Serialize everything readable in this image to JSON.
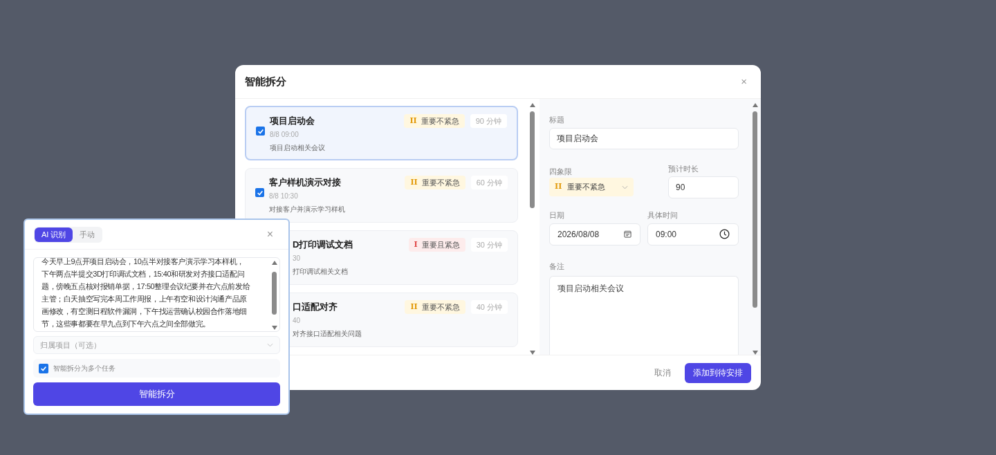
{
  "dialog": {
    "title": "智能拆分",
    "close": "×",
    "tasks": [
      {
        "title": "项目启动会",
        "time": "8/8 09:00",
        "note": "项目启动相关会议",
        "checked": true,
        "selected": true,
        "badge": {
          "mark": "II",
          "label": "重要不紧急",
          "kind": "not_urgent"
        },
        "duration": "90 分钟"
      },
      {
        "title": "客户样机演示对接",
        "time": "8/8 10:30",
        "note": "对接客户并演示学习样机",
        "checked": true,
        "selected": false,
        "badge": {
          "mark": "II",
          "label": "重要不紧急",
          "kind": "not_urgent"
        },
        "duration": "60 分钟"
      },
      {
        "title": "D打印调试文档",
        "time": "30",
        "note": "打印调试相关文档",
        "selected": false,
        "badge": {
          "mark": "I",
          "label": "重要且紧急",
          "kind": "urgent"
        },
        "duration": "30 分钟"
      },
      {
        "title": "口适配对齐",
        "time": "40",
        "note": "对齐接口适配相关问题",
        "selected": false,
        "badge": {
          "mark": "II",
          "label": "重要不紧急",
          "kind": "not_urgent"
        },
        "duration": "40 分钟"
      }
    ],
    "form": {
      "title_label": "标题",
      "title_value": "项目启动会",
      "quadrant_label": "四象限",
      "quadrant": {
        "mark": "II",
        "label": "重要不紧急",
        "kind": "not_urgent"
      },
      "duration_label": "预计时长",
      "duration_value": "90",
      "date_label": "日期",
      "date_value": "2026/08/08",
      "time_label": "具体时间",
      "time_value": "09:00",
      "note_label": "备注",
      "note_value": "项目启动相关会议"
    },
    "buttons": [
      {
        "label": "取消",
        "kind": "secondary"
      },
      {
        "label": "添加到待安排",
        "kind": "primary"
      }
    ]
  },
  "input_panel": {
    "tabs": [
      {
        "label": "AI 识别",
        "selected": true
      },
      {
        "label": "手动",
        "selected": false
      }
    ],
    "close": "×",
    "text_lines": [
      "今天早上9点开项目启动会，10点半对接客户演示学习本样机，",
      "下午两点半提交3D打印调试文档，15:40和研发对齐接口适配问",
      "题，傍晚五点核对报销单据，17:50整理会议纪要并在六点前发给",
      "主管；白天抽空写完本周工作周报，上午有空和设计沟通产品原",
      "画修改，有空测日程软件漏洞，下午找运营确认校园合作落地细",
      "节，这些事都要在早九点到下午六点之间全部做完。"
    ],
    "project_placeholder": "归属项目（可选）",
    "split": {
      "label": "智能拆分为多个任务",
      "checked": true
    },
    "submit": "智能拆分"
  }
}
